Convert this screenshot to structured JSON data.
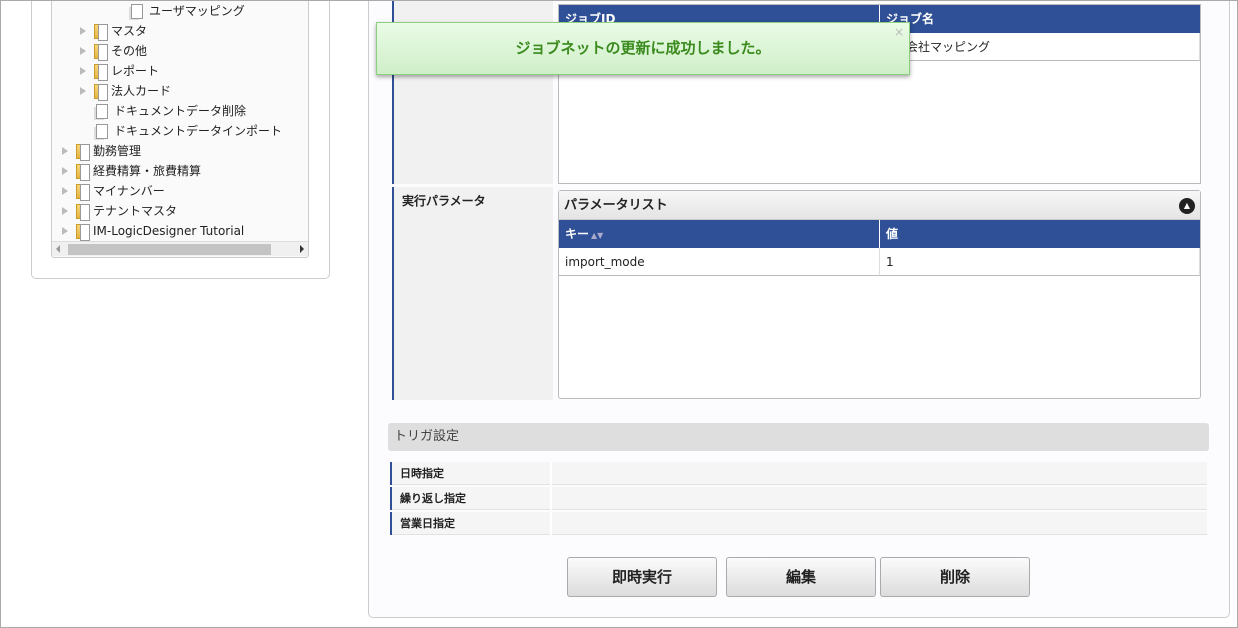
{
  "tree": {
    "items": [
      {
        "label": "ユーザマッピング",
        "type": "doc"
      },
      {
        "label": "マスタ",
        "type": "folder"
      },
      {
        "label": "その他",
        "type": "folder"
      },
      {
        "label": "レポート",
        "type": "folder"
      },
      {
        "label": "法人カード",
        "type": "folder"
      },
      {
        "label": "ドキュメントデータ削除",
        "type": "doc"
      },
      {
        "label": "ドキュメントデータインポート",
        "type": "doc"
      },
      {
        "label": "勤務管理",
        "type": "folder"
      },
      {
        "label": "経費精算・旅費精算",
        "type": "folder"
      },
      {
        "label": "マイナンバー",
        "type": "folder"
      },
      {
        "label": "テナントマスタ",
        "type": "folder"
      },
      {
        "label": "IM-LogicDesigner Tutorial",
        "type": "folder"
      }
    ]
  },
  "toast": {
    "message": "ジョブネットの更新に成功しました。",
    "close": "×"
  },
  "jobs": {
    "headers": [
      "ジョブID",
      "ジョブ名"
    ],
    "rows": [
      [
        "",
        "・会社マッピング"
      ]
    ]
  },
  "params": {
    "label": "実行パラメータ",
    "panel_title": "パラメータリスト",
    "headers": [
      "キー",
      "値"
    ],
    "rows": [
      [
        "import_mode",
        "1"
      ]
    ]
  },
  "trigger": {
    "title": "トリガ設定",
    "rows": [
      "日時指定",
      "繰り返し指定",
      "営業日指定"
    ]
  },
  "buttons": {
    "run": "即時実行",
    "edit": "編集",
    "delete": "削除"
  },
  "colors": {
    "header": "#2f4f96",
    "toast_text": "#3a8a1d"
  }
}
